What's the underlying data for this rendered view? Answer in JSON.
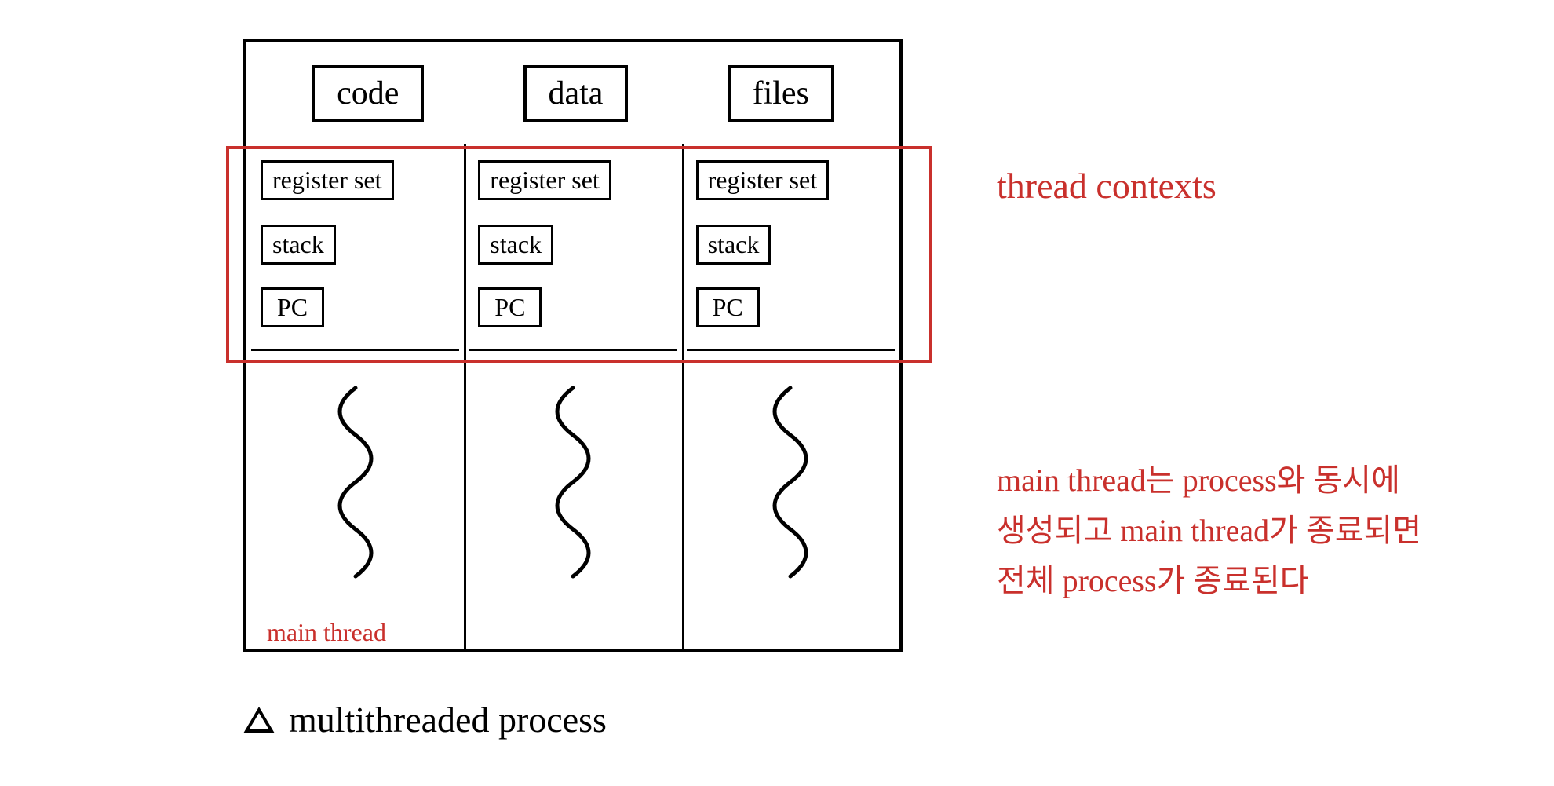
{
  "shared": {
    "code": "code",
    "data": "data",
    "files": "files"
  },
  "threads": [
    {
      "register": "register set",
      "stack": "stack",
      "pc": "PC"
    },
    {
      "register": "register set",
      "stack": "stack",
      "pc": "PC"
    },
    {
      "register": "register set",
      "stack": "stack",
      "pc": "PC"
    }
  ],
  "annotations": {
    "thread_contexts": "thread contexts",
    "main_thread": "main thread",
    "description_line1": "main thread는 process와 동시에",
    "description_line2": "생성되고 main thread가 종료되면",
    "description_line3": "전체 process가 종료된다"
  },
  "caption": "multithreaded process"
}
